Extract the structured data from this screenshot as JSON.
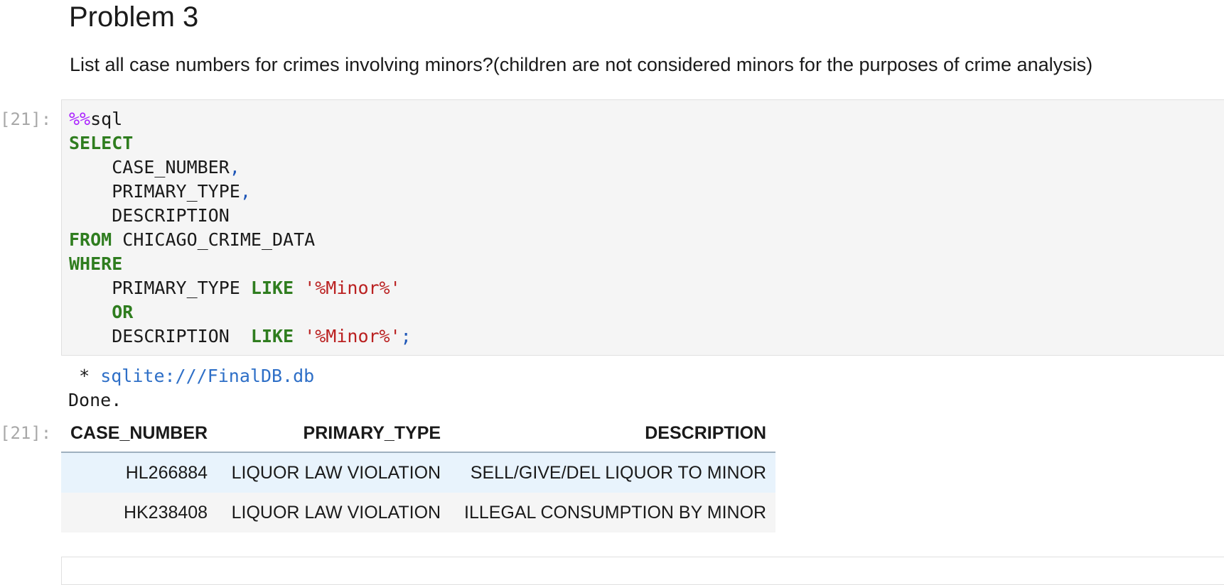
{
  "markdown": {
    "heading": "Problem 3",
    "question": "List all case numbers for crimes involving minors?(children are not considered minors for the purposes of crime analysis)"
  },
  "cell": {
    "input_prompt": "[21]:",
    "output_prompt": "[21]:",
    "code": {
      "magic_prefix": "%%",
      "magic_name": "sql",
      "select_kw": "SELECT",
      "col1": "CASE_NUMBER",
      "col2": "PRIMARY_TYPE",
      "col3": "DESCRIPTION",
      "comma": ",",
      "from_kw": "FROM",
      "table_name": "CHICAGO_CRIME_DATA",
      "where_kw": "WHERE",
      "cond1_col": "PRIMARY_TYPE",
      "like_kw": "LIKE",
      "pattern": "'%Minor%'",
      "or_kw": "OR",
      "cond2_col": "DESCRIPTION",
      "semicolon": ";"
    },
    "output": {
      "bullet": "*",
      "connection": "sqlite:///FinalDB.db",
      "status": "Done."
    },
    "result_table": {
      "headers": [
        "CASE_NUMBER",
        "PRIMARY_TYPE",
        "DESCRIPTION"
      ],
      "rows": [
        [
          "HL266884",
          "LIQUOR LAW VIOLATION",
          "SELL/GIVE/DEL LIQUOR TO MINOR"
        ],
        [
          "HK238408",
          "LIQUOR LAW VIOLATION",
          "ILLEGAL CONSUMPTION BY MINOR"
        ]
      ]
    }
  },
  "colors": {
    "keyword": "#2f7d1f",
    "magic": "#aa22ff",
    "string": "#ba2121",
    "punctuation": "#1f57b8",
    "link": "#2e6fc7",
    "row_highlight": "#e8f3fc",
    "cell_background": "#f5f5f5"
  }
}
